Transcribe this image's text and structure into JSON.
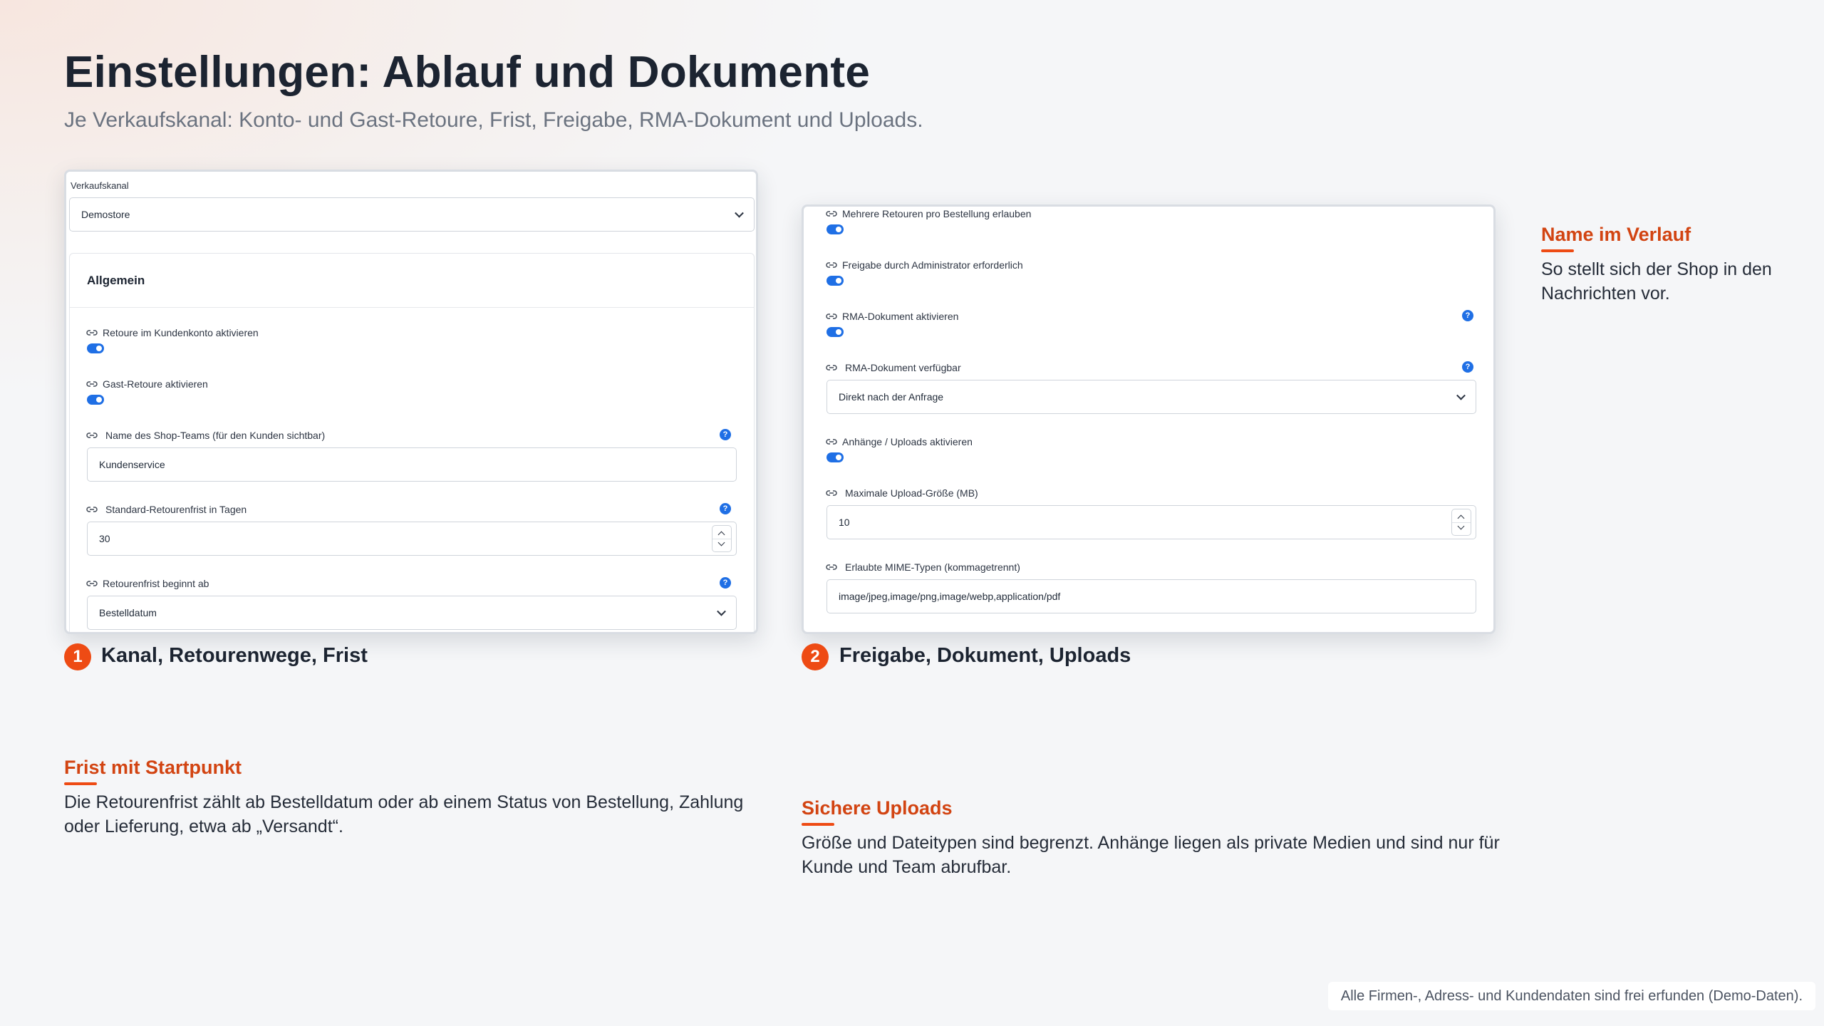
{
  "header": {
    "title": "Einstellungen: Ablauf und Dokumente",
    "subtitle": "Je Verkaufskanal: Konto- und Gast-Retoure, Frist, Freigabe, RMA-Dokument und Uploads."
  },
  "screen1": {
    "channel_label": "Verkaufskanal",
    "channel_value": "Demostore",
    "section_title": "Allgemein",
    "account_return_label": "Retoure im Kundenkonto aktivieren",
    "account_return_enabled": true,
    "guest_return_label": "Gast-Retoure aktivieren",
    "guest_return_enabled": true,
    "team_name_label": "Name des Shop-Teams (für den Kunden sichtbar)",
    "team_name_value": "Kundenservice",
    "deadline_label": "Standard-Retourenfrist in Tagen",
    "deadline_value": "30",
    "deadline_start_label": "Retourenfrist beginnt ab",
    "deadline_start_value": "Bestelldatum"
  },
  "screen2": {
    "multiple_returns_label": "Mehrere Retouren pro Bestellung erlauben",
    "multiple_returns_enabled": true,
    "admin_approval_label": "Freigabe durch Administrator erforderlich",
    "admin_approval_enabled": true,
    "rma_enable_label": "RMA-Dokument aktivieren",
    "rma_enable_enabled": true,
    "rma_available_label": "RMA-Dokument verfügbar",
    "rma_available_value": "Direkt nach der Anfrage",
    "uploads_label": "Anhänge / Uploads aktivieren",
    "uploads_enabled": true,
    "max_upload_label": "Maximale Upload-Größe (MB)",
    "max_upload_value": "10",
    "mime_label": "Erlaubte MIME-Typen (kommagetrennt)",
    "mime_value": "image/jpeg,image/png,image/webp,application/pdf"
  },
  "steps": [
    {
      "number": "1",
      "label": "Kanal, Retourenwege, Frist"
    },
    {
      "number": "2",
      "label": "Freigabe, Dokument, Uploads"
    }
  ],
  "notes": {
    "name": {
      "title": "Name im Verlauf",
      "body": "So stellt sich der Shop in den Nachrichten vor."
    },
    "deadline": {
      "title": "Frist mit Startpunkt",
      "body": "Die Retourenfrist zählt ab Bestelldatum oder ab einem Status von Bestellung, Zahlung oder Lieferung, etwa ab „Versandt“."
    },
    "uploads": {
      "title": "Sichere Uploads",
      "body": "Größe und Dateitypen sind begrenzt. Anhänge liegen als private Medien und sind nur für Kunde und Team abrufbar."
    }
  },
  "help_glyph": "?",
  "footer": "Alle Firmen-, Adress- und Kundendaten sind frei erfunden (Demo-Daten).",
  "colors": {
    "accent": "#ee4b14",
    "toggle_on": "#1f6fe5",
    "note_title": "#d24412"
  }
}
